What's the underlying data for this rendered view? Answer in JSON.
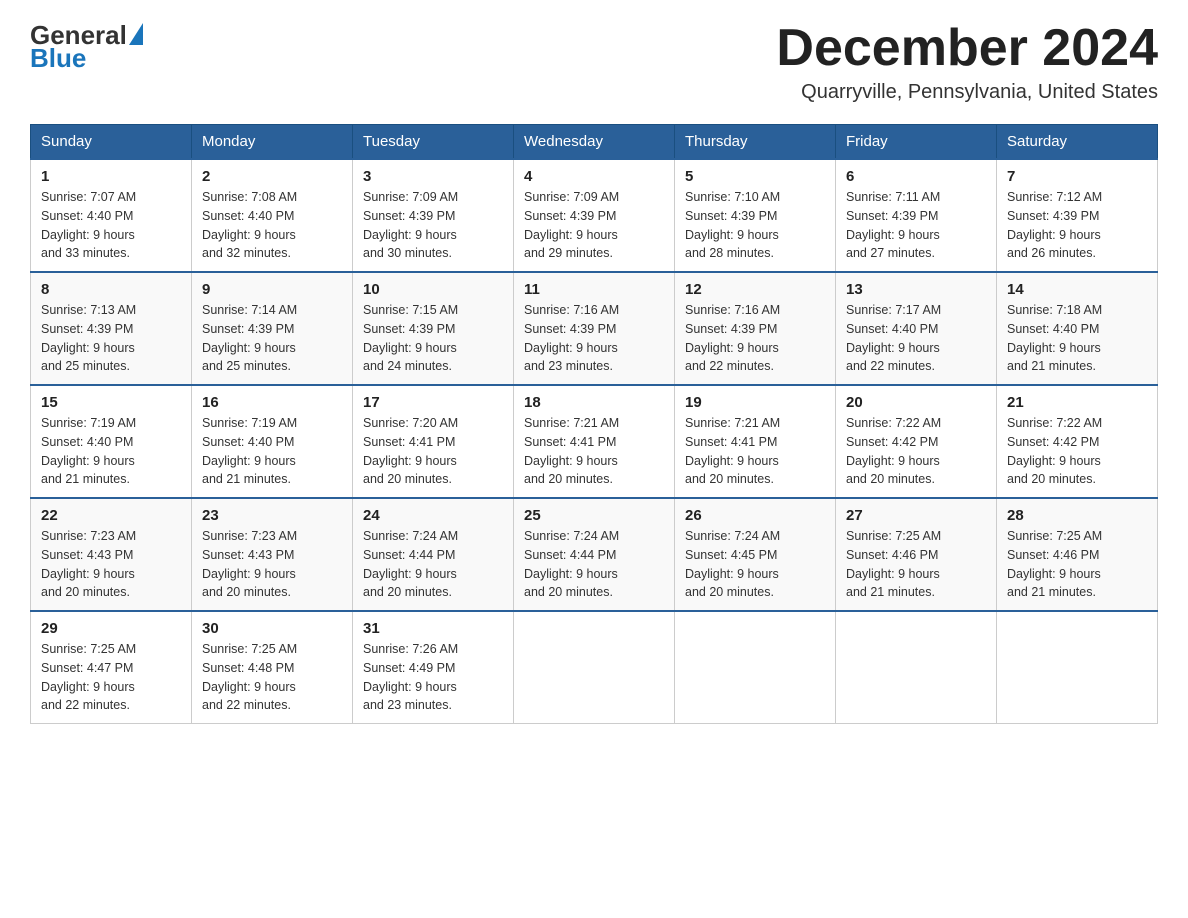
{
  "header": {
    "logo": {
      "general": "General",
      "blue": "Blue"
    },
    "title": "December 2024",
    "location": "Quarryville, Pennsylvania, United States"
  },
  "days_of_week": [
    "Sunday",
    "Monday",
    "Tuesday",
    "Wednesday",
    "Thursday",
    "Friday",
    "Saturday"
  ],
  "weeks": [
    [
      {
        "day": "1",
        "sunrise": "7:07 AM",
        "sunset": "4:40 PM",
        "daylight": "9 hours and 33 minutes."
      },
      {
        "day": "2",
        "sunrise": "7:08 AM",
        "sunset": "4:40 PM",
        "daylight": "9 hours and 32 minutes."
      },
      {
        "day": "3",
        "sunrise": "7:09 AM",
        "sunset": "4:39 PM",
        "daylight": "9 hours and 30 minutes."
      },
      {
        "day": "4",
        "sunrise": "7:09 AM",
        "sunset": "4:39 PM",
        "daylight": "9 hours and 29 minutes."
      },
      {
        "day": "5",
        "sunrise": "7:10 AM",
        "sunset": "4:39 PM",
        "daylight": "9 hours and 28 minutes."
      },
      {
        "day": "6",
        "sunrise": "7:11 AM",
        "sunset": "4:39 PM",
        "daylight": "9 hours and 27 minutes."
      },
      {
        "day": "7",
        "sunrise": "7:12 AM",
        "sunset": "4:39 PM",
        "daylight": "9 hours and 26 minutes."
      }
    ],
    [
      {
        "day": "8",
        "sunrise": "7:13 AM",
        "sunset": "4:39 PM",
        "daylight": "9 hours and 25 minutes."
      },
      {
        "day": "9",
        "sunrise": "7:14 AM",
        "sunset": "4:39 PM",
        "daylight": "9 hours and 25 minutes."
      },
      {
        "day": "10",
        "sunrise": "7:15 AM",
        "sunset": "4:39 PM",
        "daylight": "9 hours and 24 minutes."
      },
      {
        "day": "11",
        "sunrise": "7:16 AM",
        "sunset": "4:39 PM",
        "daylight": "9 hours and 23 minutes."
      },
      {
        "day": "12",
        "sunrise": "7:16 AM",
        "sunset": "4:39 PM",
        "daylight": "9 hours and 22 minutes."
      },
      {
        "day": "13",
        "sunrise": "7:17 AM",
        "sunset": "4:40 PM",
        "daylight": "9 hours and 22 minutes."
      },
      {
        "day": "14",
        "sunrise": "7:18 AM",
        "sunset": "4:40 PM",
        "daylight": "9 hours and 21 minutes."
      }
    ],
    [
      {
        "day": "15",
        "sunrise": "7:19 AM",
        "sunset": "4:40 PM",
        "daylight": "9 hours and 21 minutes."
      },
      {
        "day": "16",
        "sunrise": "7:19 AM",
        "sunset": "4:40 PM",
        "daylight": "9 hours and 21 minutes."
      },
      {
        "day": "17",
        "sunrise": "7:20 AM",
        "sunset": "4:41 PM",
        "daylight": "9 hours and 20 minutes."
      },
      {
        "day": "18",
        "sunrise": "7:21 AM",
        "sunset": "4:41 PM",
        "daylight": "9 hours and 20 minutes."
      },
      {
        "day": "19",
        "sunrise": "7:21 AM",
        "sunset": "4:41 PM",
        "daylight": "9 hours and 20 minutes."
      },
      {
        "day": "20",
        "sunrise": "7:22 AM",
        "sunset": "4:42 PM",
        "daylight": "9 hours and 20 minutes."
      },
      {
        "day": "21",
        "sunrise": "7:22 AM",
        "sunset": "4:42 PM",
        "daylight": "9 hours and 20 minutes."
      }
    ],
    [
      {
        "day": "22",
        "sunrise": "7:23 AM",
        "sunset": "4:43 PM",
        "daylight": "9 hours and 20 minutes."
      },
      {
        "day": "23",
        "sunrise": "7:23 AM",
        "sunset": "4:43 PM",
        "daylight": "9 hours and 20 minutes."
      },
      {
        "day": "24",
        "sunrise": "7:24 AM",
        "sunset": "4:44 PM",
        "daylight": "9 hours and 20 minutes."
      },
      {
        "day": "25",
        "sunrise": "7:24 AM",
        "sunset": "4:44 PM",
        "daylight": "9 hours and 20 minutes."
      },
      {
        "day": "26",
        "sunrise": "7:24 AM",
        "sunset": "4:45 PM",
        "daylight": "9 hours and 20 minutes."
      },
      {
        "day": "27",
        "sunrise": "7:25 AM",
        "sunset": "4:46 PM",
        "daylight": "9 hours and 21 minutes."
      },
      {
        "day": "28",
        "sunrise": "7:25 AM",
        "sunset": "4:46 PM",
        "daylight": "9 hours and 21 minutes."
      }
    ],
    [
      {
        "day": "29",
        "sunrise": "7:25 AM",
        "sunset": "4:47 PM",
        "daylight": "9 hours and 22 minutes."
      },
      {
        "day": "30",
        "sunrise": "7:25 AM",
        "sunset": "4:48 PM",
        "daylight": "9 hours and 22 minutes."
      },
      {
        "day": "31",
        "sunrise": "7:26 AM",
        "sunset": "4:49 PM",
        "daylight": "9 hours and 23 minutes."
      },
      null,
      null,
      null,
      null
    ]
  ],
  "labels": {
    "sunrise": "Sunrise:",
    "sunset": "Sunset:",
    "daylight": "Daylight:"
  }
}
